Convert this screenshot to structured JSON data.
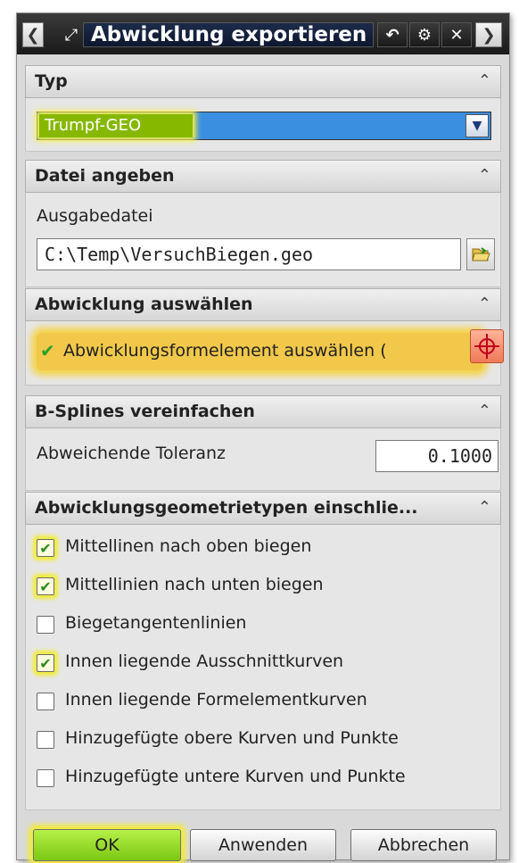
{
  "titlebar": {
    "prev_icon": "chevron-left-icon",
    "pointer_icon": "arrow-pointer-icon",
    "title": "Abwicklung exportieren",
    "reset_icon": "reset-icon",
    "settings_icon": "gear-icon",
    "close_icon": "close-icon",
    "next_icon": "chevron-right-icon"
  },
  "sections": {
    "typ": {
      "header": "Typ",
      "selected": "Trumpf-GEO"
    },
    "datei": {
      "header": "Datei angeben",
      "output_label": "Ausgabedatei",
      "output_value": "C:\\Temp\\VersuchBiegen.geo"
    },
    "abwicklung": {
      "header": "Abwicklung auswählen",
      "select_label": "Abwicklungsformelement auswählen ("
    },
    "bsplines": {
      "header": "B-Splines vereinfachen",
      "tolerance_label": "Abweichende Toleranz",
      "tolerance_value": "0.1000"
    },
    "geometrietypen": {
      "header": "Abwicklungsgeometrietypen einschlie...",
      "items": [
        {
          "label": "Mittellinen nach oben biegen",
          "checked": true
        },
        {
          "label": "Mittellinien nach unten biegen",
          "checked": true
        },
        {
          "label": "Biegetangentenlinien",
          "checked": false
        },
        {
          "label": "Innen liegende Ausschnittkurven",
          "checked": true
        },
        {
          "label": "Innen liegende Formelementkurven",
          "checked": false
        },
        {
          "label": "Hinzugefügte obere Kurven und Punkte",
          "checked": false
        },
        {
          "label": "Hinzugefügte untere Kurven und Punkte",
          "checked": false
        }
      ]
    }
  },
  "buttons": {
    "ok": "OK",
    "apply": "Anwenden",
    "cancel": "Abbrechen"
  },
  "colors": {
    "highlight": "#f2ec3a",
    "ok_green": "#86d21e",
    "dropdown_blue": "#3a8fe0",
    "check_green": "#2a8a1a"
  }
}
